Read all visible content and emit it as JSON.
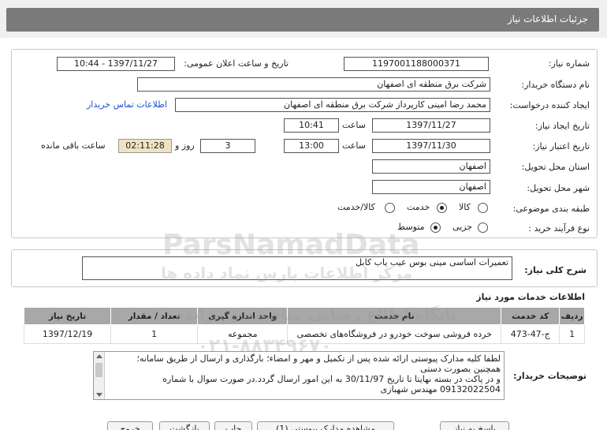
{
  "header": {
    "title": "جزئیات اطلاعات نیاز"
  },
  "form": {
    "need_number_label": "شماره نیاز:",
    "need_number": "1197001188000371",
    "announce_label": "تاریخ و ساعت اعلان عمومی:",
    "announce_value": "1397/11/27 - 10:44",
    "buyer_org_label": "نام دستگاه خریدار:",
    "buyer_org": "شرکت برق منطقه ای اصفهان",
    "requester_label": "ایجاد کننده درخواست:",
    "requester": "محمد رضا امینی کارپرداز شرکت برق منطقه ای اصفهان",
    "buyer_contact_link": "اطلاعات تماس خریدار",
    "created_label": "تاریخ ایجاد نیاز:",
    "created_date": "1397/11/27",
    "time_label": "ساعت",
    "created_time": "10:41",
    "validity_label": "تاریخ اعتبار نیاز:",
    "validity_date": "1397/11/30",
    "validity_time": "13:00",
    "days_value": "3",
    "days_label": "روز و",
    "remaining_value": "02:11:28",
    "remaining_label": "ساعت باقی مانده",
    "province_label": "استان محل تحویل:",
    "province": "اصفهان",
    "city_label": "شهر محل تحویل:",
    "city": "اصفهان",
    "category_label": "طبقه بندی موضوعی:",
    "category_options": [
      "کالا",
      "خدمت",
      "کالا/خدمت"
    ],
    "process_label": "نوع فرآیند خرید :",
    "process_options": [
      "جزیی",
      "متوسط"
    ]
  },
  "summary": {
    "label": "شرح کلی نیاز:",
    "value": "تعمیرات اساسی مینی بوس عیب یاب کابل"
  },
  "services": {
    "title": "اطلاعات خدمات مورد نیاز",
    "headers": [
      "ردیف",
      "کد خدمت",
      "نام خدمت",
      "واحد اندازه گیری",
      "تعداد / مقدار",
      "تاریخ نیاز"
    ],
    "rows": [
      [
        "1",
        "ج-47-473",
        "خرده فروشی سوخت خودرو در فروشگاه‌های تخصصی",
        "مجموعه",
        "1",
        "1397/12/19"
      ]
    ]
  },
  "buyer_notes": {
    "label": "توضیحات خریدار:",
    "line1": "لطفا کلیه مدارک پیوستی ارائه شده  پس از تکمیل و مهر و امضاء؛ بارگذاری و ارسال از طریق سامانه؛",
    "line2": "همچنین بصورت دستی",
    "line3": "و در پاکت در بسته نهایتا تا تاریخ  30/11/97 به این امور ارسال گردد.در صورت سوال با شماره",
    "line4": "09132022504 مهندس شهبازی"
  },
  "buttons": {
    "reply": "پاسخ به نیاز",
    "view_docs": "مشاهده مدارک پیوستی (1)",
    "print": "چاپ",
    "back": "بازگشت",
    "exit": "خروج"
  },
  "watermark": {
    "line1": "ParsNamadData",
    "line2": "پایگاه اطلاع رسانی مناقصه و مزایده",
    "line3": "مرکز اطلاعات پارس نماد داده ها",
    "line4": "۰۲۱-۸۸۳۴۹۶۷۰"
  },
  "colors": {
    "header_bar": "#7a7a7a",
    "link": "#1a4fd6",
    "remaining_bg": "#efe3c2",
    "table_header": "#a8a8a8"
  }
}
